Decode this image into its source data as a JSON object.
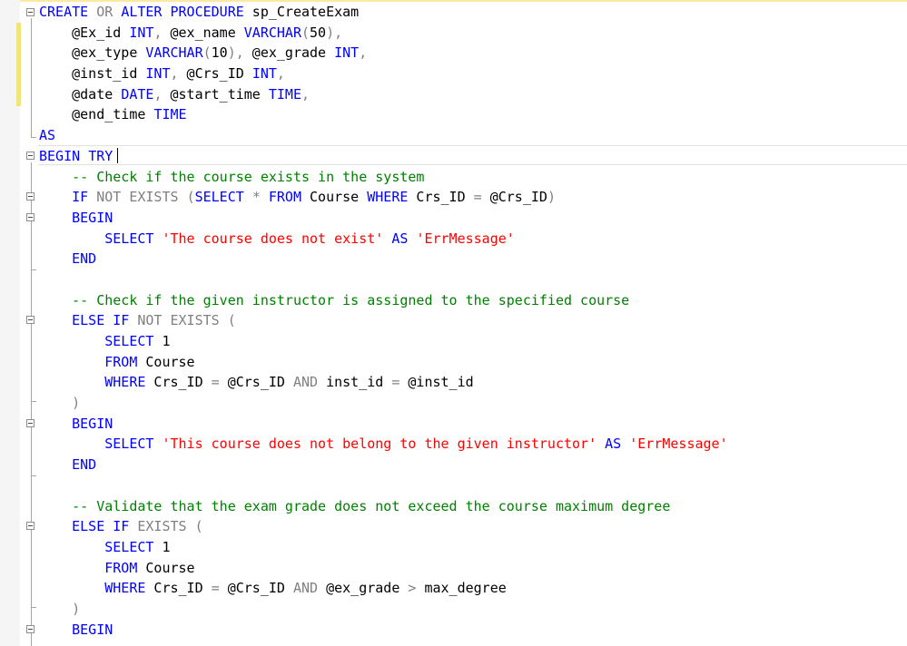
{
  "editor": {
    "lines": [
      [
        [
          "kw",
          "CREATE"
        ],
        [
          "txt",
          " "
        ],
        [
          "op",
          "OR"
        ],
        [
          "txt",
          " "
        ],
        [
          "kw",
          "ALTER"
        ],
        [
          "txt",
          " "
        ],
        [
          "kw",
          "PROCEDURE"
        ],
        [
          "txt",
          " sp_CreateExam"
        ]
      ],
      [
        [
          "txt",
          "    @Ex_id "
        ],
        [
          "kw",
          "INT"
        ],
        [
          "op",
          ","
        ],
        [
          "txt",
          " @ex_name "
        ],
        [
          "kw",
          "VARCHAR"
        ],
        [
          "op",
          "("
        ],
        [
          "txt",
          "50"
        ],
        [
          "op",
          "),"
        ]
      ],
      [
        [
          "txt",
          "    @ex_type "
        ],
        [
          "kw",
          "VARCHAR"
        ],
        [
          "op",
          "("
        ],
        [
          "txt",
          "10"
        ],
        [
          "op",
          "),"
        ],
        [
          "txt",
          " @ex_grade "
        ],
        [
          "kw",
          "INT"
        ],
        [
          "op",
          ","
        ]
      ],
      [
        [
          "txt",
          "    @inst_id "
        ],
        [
          "kw",
          "INT"
        ],
        [
          "op",
          ","
        ],
        [
          "txt",
          " @Crs_ID "
        ],
        [
          "kw",
          "INT"
        ],
        [
          "op",
          ","
        ]
      ],
      [
        [
          "txt",
          "    @date "
        ],
        [
          "kw",
          "DATE"
        ],
        [
          "op",
          ","
        ],
        [
          "txt",
          " @start_time "
        ],
        [
          "kw",
          "TIME"
        ],
        [
          "op",
          ","
        ]
      ],
      [
        [
          "txt",
          "    @end_time "
        ],
        [
          "kw",
          "TIME"
        ]
      ],
      [
        [
          "kw",
          "AS"
        ]
      ],
      [
        [
          "kw",
          "BEGIN"
        ],
        [
          "txt",
          " "
        ],
        [
          "kw",
          "TRY"
        ]
      ],
      [
        [
          "txt",
          "    "
        ],
        [
          "cm",
          "-- Check if the course exists in the system"
        ]
      ],
      [
        [
          "txt",
          "    "
        ],
        [
          "kw",
          "IF"
        ],
        [
          "txt",
          " "
        ],
        [
          "op",
          "NOT"
        ],
        [
          "txt",
          " "
        ],
        [
          "op",
          "EXISTS"
        ],
        [
          "txt",
          " "
        ],
        [
          "op",
          "("
        ],
        [
          "kw",
          "SELECT"
        ],
        [
          "txt",
          " "
        ],
        [
          "op",
          "*"
        ],
        [
          "txt",
          " "
        ],
        [
          "kw",
          "FROM"
        ],
        [
          "txt",
          " Course "
        ],
        [
          "kw",
          "WHERE"
        ],
        [
          "txt",
          " Crs_ID "
        ],
        [
          "op",
          "="
        ],
        [
          "txt",
          " @Crs_ID"
        ],
        [
          "op",
          ")"
        ]
      ],
      [
        [
          "txt",
          "    "
        ],
        [
          "kw",
          "BEGIN"
        ]
      ],
      [
        [
          "txt",
          "        "
        ],
        [
          "kw",
          "SELECT"
        ],
        [
          "txt",
          " "
        ],
        [
          "str",
          "'The course does not exist'"
        ],
        [
          "txt",
          " "
        ],
        [
          "kw",
          "AS"
        ],
        [
          "txt",
          " "
        ],
        [
          "str",
          "'ErrMessage'"
        ]
      ],
      [
        [
          "txt",
          "    "
        ],
        [
          "kw",
          "END"
        ]
      ],
      [
        [
          "txt",
          ""
        ]
      ],
      [
        [
          "txt",
          "    "
        ],
        [
          "cm",
          "-- Check if the given instructor is assigned to the specified course"
        ]
      ],
      [
        [
          "txt",
          "    "
        ],
        [
          "kw",
          "ELSE"
        ],
        [
          "txt",
          " "
        ],
        [
          "kw",
          "IF"
        ],
        [
          "txt",
          " "
        ],
        [
          "op",
          "NOT"
        ],
        [
          "txt",
          " "
        ],
        [
          "op",
          "EXISTS"
        ],
        [
          "txt",
          " "
        ],
        [
          "op",
          "("
        ]
      ],
      [
        [
          "txt",
          "        "
        ],
        [
          "kw",
          "SELECT"
        ],
        [
          "txt",
          " 1"
        ]
      ],
      [
        [
          "txt",
          "        "
        ],
        [
          "kw",
          "FROM"
        ],
        [
          "txt",
          " Course"
        ]
      ],
      [
        [
          "txt",
          "        "
        ],
        [
          "kw",
          "WHERE"
        ],
        [
          "txt",
          " Crs_ID "
        ],
        [
          "op",
          "="
        ],
        [
          "txt",
          " @Crs_ID "
        ],
        [
          "op",
          "AND"
        ],
        [
          "txt",
          " inst_id "
        ],
        [
          "op",
          "="
        ],
        [
          "txt",
          " @inst_id"
        ]
      ],
      [
        [
          "txt",
          "    "
        ],
        [
          "op",
          ")"
        ]
      ],
      [
        [
          "txt",
          "    "
        ],
        [
          "kw",
          "BEGIN"
        ]
      ],
      [
        [
          "txt",
          "        "
        ],
        [
          "kw",
          "SELECT"
        ],
        [
          "txt",
          " "
        ],
        [
          "str",
          "'This course does not belong to the given instructor'"
        ],
        [
          "txt",
          " "
        ],
        [
          "kw",
          "AS"
        ],
        [
          "txt",
          " "
        ],
        [
          "str",
          "'ErrMessage'"
        ]
      ],
      [
        [
          "txt",
          "    "
        ],
        [
          "kw",
          "END"
        ]
      ],
      [
        [
          "txt",
          ""
        ]
      ],
      [
        [
          "txt",
          "    "
        ],
        [
          "cm",
          "-- Validate that the exam grade does not exceed the course maximum degree"
        ]
      ],
      [
        [
          "txt",
          "    "
        ],
        [
          "kw",
          "ELSE"
        ],
        [
          "txt",
          " "
        ],
        [
          "kw",
          "IF"
        ],
        [
          "txt",
          " "
        ],
        [
          "op",
          "EXISTS"
        ],
        [
          "txt",
          " "
        ],
        [
          "op",
          "("
        ]
      ],
      [
        [
          "txt",
          "        "
        ],
        [
          "kw",
          "SELECT"
        ],
        [
          "txt",
          " 1"
        ]
      ],
      [
        [
          "txt",
          "        "
        ],
        [
          "kw",
          "FROM"
        ],
        [
          "txt",
          " Course"
        ]
      ],
      [
        [
          "txt",
          "        "
        ],
        [
          "kw",
          "WHERE"
        ],
        [
          "txt",
          " Crs_ID "
        ],
        [
          "op",
          "="
        ],
        [
          "txt",
          " @Crs_ID "
        ],
        [
          "op",
          "AND"
        ],
        [
          "txt",
          " @ex_grade "
        ],
        [
          "op",
          ">"
        ],
        [
          "txt",
          " max_degree"
        ]
      ],
      [
        [
          "txt",
          "    "
        ],
        [
          "op",
          ")"
        ]
      ],
      [
        [
          "txt",
          "    "
        ],
        [
          "kw",
          "BEGIN"
        ]
      ]
    ]
  },
  "colors": {
    "keyword": "#0000ff",
    "operator": "#808080",
    "string": "#ff0000",
    "comment": "#008000",
    "text": "#000000",
    "change_marker": "#f0e47a"
  }
}
